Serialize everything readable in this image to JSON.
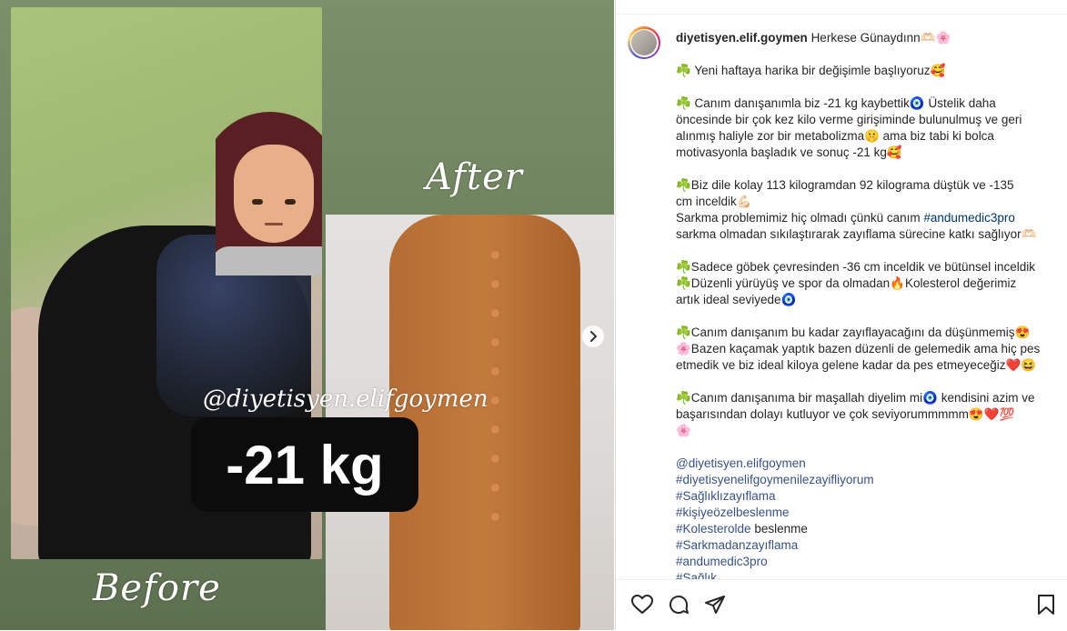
{
  "post": {
    "overlay": {
      "after_text": "After",
      "before_text": "Before",
      "handle": "@diyetisyen.elifgoymen",
      "result_text": "-21 kg"
    },
    "carousel": {
      "next_icon": "chevron-right-icon"
    }
  },
  "caption": {
    "username": "diyetisyen.elif.goymen",
    "greeting": "Herkese Günaydınn🫶🏻🌸",
    "line1": "☘️ Yeni haftaya harika bir değişimle başlıyoruz🥰",
    "para2_a": "☘️ Canım danışanımla biz -21 kg kaybettik🧿 Üstelik daha",
    "para2_b": "öncesinde bir çok kez kilo verme girişiminde bulunulmuş ve geri",
    "para2_c": "alınmış haliyle zor bir metabolizma🤫 ama biz tabi ki bolca",
    "para2_d": "motivasyonla başladık ve sonuç -21 kg🥰",
    "para3_a": "☘️Biz dile kolay 113 kilogramdan 92 kilograma düştük ve -135",
    "para3_b": "cm inceldik💪🏻",
    "para3_c_pre": "Sarkma problemimiz hiç olmadı çünkü canım ",
    "para3_c_tag": "#andumedic3pro",
    "para3_d": "sarkma olmadan sıkılaştırarak zayıflama sürecine katkı sağlıyor🫶🏻",
    "para4_a": "☘️Sadece göbek çevresinden -36 cm inceldik ve bütünsel inceldik",
    "para4_b": "☘️Düzenli yürüyüş ve spor da olmadan🔥Kolesterol değerimiz",
    "para4_c": "artık ideal seviyede🧿",
    "para5_a": "☘️Canım danışanım bu kadar zayıflayacağını da düşünmemiş😍",
    "para5_b": "🌸Bazen kaçamak yaptık bazen düzenli de gelemedik ama hiç pes",
    "para5_c": "etmedik ve biz ideal kiloya gelene kadar da pes etmeyeceğiz❤️😆",
    "para6_a": "☘️Canım danışanıma bir maşallah diyelim mi🧿 kendisini azim ve",
    "para6_b": "başarısından dolayı kutluyor ve çok seviyorummmmm😍❤️💯",
    "para6_c": "🌸",
    "tags": [
      "@diyetisyen.elifgoymen",
      "#diyetisyenelifgoymenilezayifliyorum",
      "#Sağlıklızayıflama",
      "#kişiyeözelbeslenme",
      "#Kolesterolde",
      "#Sarkmadanzayıflama",
      "#andumedic3pro",
      "#Sağlık"
    ],
    "tag5_suffix": " beslenme"
  },
  "actions": {
    "like": "heart-icon",
    "comment": "comment-icon",
    "share": "send-icon",
    "save": "bookmark-icon"
  }
}
